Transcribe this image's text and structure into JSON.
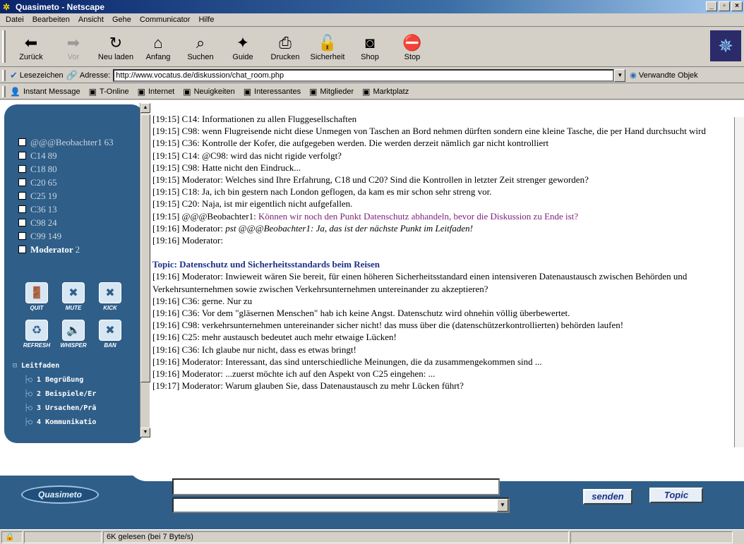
{
  "window": {
    "title": "Quasimeto - Netscape",
    "buttons": [
      "_",
      "▫",
      "×"
    ]
  },
  "menubar": [
    "Datei",
    "Bearbeiten",
    "Ansicht",
    "Gehe",
    "Communicator",
    "Hilfe"
  ],
  "toolbar": [
    {
      "label": "Zurück",
      "icon": "back-icon",
      "glyph": "⬅"
    },
    {
      "label": "Vor",
      "icon": "forward-icon",
      "glyph": "➡"
    },
    {
      "label": "Neu laden",
      "icon": "reload-icon",
      "glyph": "↻"
    },
    {
      "label": "Anfang",
      "icon": "home-icon",
      "glyph": "⌂"
    },
    {
      "label": "Suchen",
      "icon": "search-icon",
      "glyph": "⌕"
    },
    {
      "label": "Guide",
      "icon": "guide-icon",
      "glyph": "✦"
    },
    {
      "label": "Drucken",
      "icon": "print-icon",
      "glyph": "⎙"
    },
    {
      "label": "Sicherheit",
      "icon": "lock-icon",
      "glyph": "🔓"
    },
    {
      "label": "Shop",
      "icon": "shop-icon",
      "glyph": "◙"
    },
    {
      "label": "Stop",
      "icon": "stop-icon",
      "glyph": "⛔"
    }
  ],
  "location": {
    "bookmarks_label": "Lesezeichen",
    "address_label": "Adresse:",
    "url": "http://www.vocatus.de/diskussion/chat_room.php",
    "related_label": "Verwandte Objek"
  },
  "personal_toolbar": [
    "Instant Message",
    "T-Online",
    "Internet",
    "Neuigkeiten",
    "Interessantes",
    "Mitglieder",
    "Marktplatz"
  ],
  "users": [
    {
      "name": "@@@Beobachter1",
      "count": "63"
    },
    {
      "name": "C14",
      "count": "89"
    },
    {
      "name": "C18",
      "count": "80"
    },
    {
      "name": "C20",
      "count": "65"
    },
    {
      "name": "C25",
      "count": "19"
    },
    {
      "name": "C36",
      "count": "13"
    },
    {
      "name": "C98",
      "count": "24"
    },
    {
      "name": "C99",
      "count": "149"
    },
    {
      "name": "Moderator",
      "count": "2"
    }
  ],
  "actions": [
    {
      "label": "QUIT",
      "icon": "quit-icon",
      "glyph": "🚪"
    },
    {
      "label": "MUTE",
      "icon": "mute-icon",
      "glyph": "✖"
    },
    {
      "label": "KICK",
      "icon": "kick-icon",
      "glyph": "✖"
    },
    {
      "label": "REFRESH",
      "icon": "refresh-icon",
      "glyph": "♻"
    },
    {
      "label": "WHISPER",
      "icon": "whisper-icon",
      "glyph": "🔈"
    },
    {
      "label": "BAN",
      "icon": "ban-icon",
      "glyph": "✖"
    }
  ],
  "tree": {
    "root": "Leitfaden",
    "items": [
      "1 Begrüßung",
      "2 Beispiele/Er",
      "3 Ursachen/Prä",
      "4 Kommunikatio"
    ]
  },
  "chat": [
    {
      "text": "[19:15] C14: Informationen zu allen Fluggesellschaften"
    },
    {
      "text": "[19:15] C98: wenn Flugreisende nicht diese Unmegen von Taschen an Bord nehmen dürften sondern eine kleine Tasche, die per Hand durchsucht wird"
    },
    {
      "text": "[19:15] C36: Kontrolle der Kofer, die aufgegeben werden. Die werden derzeit nämlich gar nicht kontrolliert"
    },
    {
      "text": "[19:15] C14: @C98: wird das nicht rigide verfolgt?"
    },
    {
      "text": "[19:15] C98: Hatte nicht den Eindruck..."
    },
    {
      "text": "[19:15] Moderator: Welches sind Ihre Erfahrung, C18 und C20? Sind die Kontrollen in letzter Zeit strenger geworden?"
    },
    {
      "text": "[19:15] C18: Ja, ich bin gestern nach London geflogen, da kam es mir schon sehr streng vor."
    },
    {
      "text": "[19:15] C20: Naja, ist mir eigentlich nicht aufgefallen."
    },
    {
      "prefix": "[19:15] @@@Beobachter1: ",
      "text": "Können wir noch den Punkt Datenschutz abhandeln, bevor die Diskussion zu Ende ist?",
      "style": "purple"
    },
    {
      "prefix": "[19:16] Moderator: ",
      "text": "pst @@@Beobachter1: Ja, das ist der nächste Punkt im Leitfaden!",
      "style": "ital"
    },
    {
      "text": "[19:16] Moderator:"
    },
    {
      "text": "",
      "style": "gap"
    },
    {
      "text": "Topic: Datenschutz und Sicherheitsstandards beim Reisen",
      "style": "topic"
    },
    {
      "text": "[19:16] Moderator: Inwieweit wären Sie bereit, für einen höheren Sicherheitsstandard einen intensiveren Datenaustausch zwischen Behörden und Verkehrsunternehmen sowie zwischen Verkehrsunternehmen untereinander zu akzeptieren?"
    },
    {
      "text": "[19:16] C36: gerne. Nur zu"
    },
    {
      "text": "[19:16] C36: Vor dem \"gläsernen Menschen\" hab ich keine Angst. Datenschutz wird ohnehin völlig überbewertet."
    },
    {
      "text": "[19:16] C98: verkehrsunternehmen untereinander sicher nicht! das muss über die (datenschützerkontrollierten) behörden laufen!"
    },
    {
      "text": "[19:16] C25: mehr austausch bedeutet auch mehr etwaige Lücken!"
    },
    {
      "text": "[19:16] C36: Ich glaube nur nicht, dass es etwas bringt!"
    },
    {
      "text": "[19:16] Moderator: Interessant, das sind unterschiedliche Meinungen, die da zusammengekommen sind ..."
    },
    {
      "text": "[19:16] Moderator: ...zuerst möchte ich auf den Aspekt von C25 eingehen: ..."
    },
    {
      "text": "[19:17] Moderator: Warum glauben Sie, dass Datenaustausch zu mehr Lücken führt?"
    }
  ],
  "footer": {
    "logo": "Quasimeto",
    "message_value": "",
    "send_label": "senden",
    "topic_label": "Topic"
  },
  "status": {
    "text": "6K gelesen (bei 7 Byte/s)"
  },
  "colors": {
    "panel": "#2f5e88",
    "titlebar": "#0a246a",
    "whisper": "#7b1e7a",
    "topic": "#1d2f8a"
  }
}
